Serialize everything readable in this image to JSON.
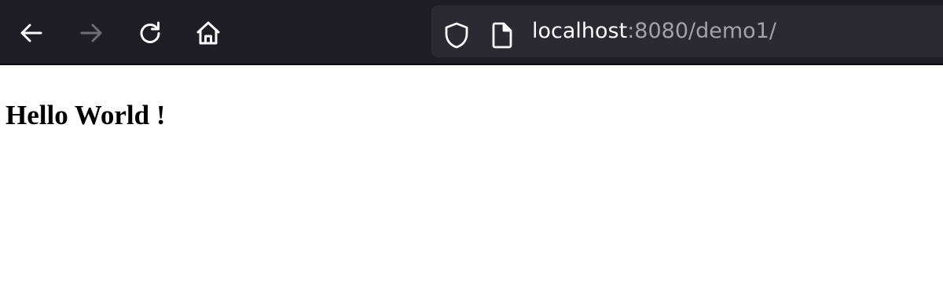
{
  "browser": {
    "toolbar": {
      "back_enabled": true,
      "forward_enabled": false
    },
    "urlbar": {
      "host": "localhost",
      "rest": ":8080/demo1/"
    },
    "icons": {
      "back": "arrow-left-icon",
      "forward": "arrow-right-icon",
      "reload": "reload-icon",
      "home": "home-icon",
      "shield": "shield-icon",
      "page": "page-icon"
    },
    "colors": {
      "toolbar_bg": "#1f1e25",
      "urlbar_bg": "#2b2a33",
      "icon": "#fbfbfe",
      "icon_disabled": "#6e6d75",
      "url_dim": "#a3a2ab"
    }
  },
  "page": {
    "heading": "Hello World !"
  }
}
